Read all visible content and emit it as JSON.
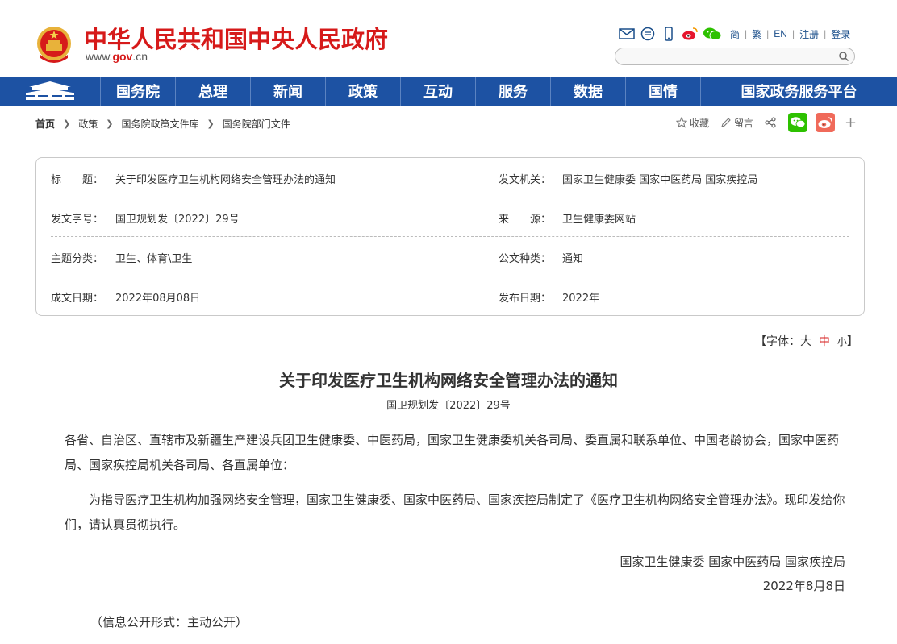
{
  "header": {
    "site_title": "中华人民共和国中央人民政府",
    "url_prefix": "www.",
    "url_gov": "gov",
    "url_suffix": ".cn",
    "lang_links": [
      "简",
      "繁",
      "EN",
      "注册",
      "登录"
    ],
    "icons": [
      "mail-icon",
      "message-icon",
      "mobile-icon",
      "weibo-icon",
      "wechat-icon"
    ],
    "search_placeholder": ""
  },
  "nav": {
    "items": [
      "国务院",
      "总理",
      "新闻",
      "政策",
      "互动",
      "服务",
      "数据",
      "国情",
      "国家政务服务平台"
    ]
  },
  "breadcrumb": [
    "首页",
    "政策",
    "国务院政策文件库",
    "国务院部门文件"
  ],
  "share": {
    "favorite": "收藏",
    "comment": "留言"
  },
  "info": {
    "rows": [
      {
        "l1": "标　　题：",
        "v1": "关于印发医疗卫生机构网络安全管理办法的通知",
        "l2": "发文机关：",
        "v2": "国家卫生健康委  国家中医药局  国家疾控局"
      },
      {
        "l1": "发文字号：",
        "v1": "国卫规划发〔2022〕29号",
        "l2": "来　　源：",
        "v2": "卫生健康委网站"
      },
      {
        "l1": "主题分类：",
        "v1": "卫生、体育\\卫生",
        "l2": "公文种类：",
        "v2": "通知"
      },
      {
        "l1": "成文日期：",
        "v1": "2022年08月08日",
        "l2": "发布日期：",
        "v2": "2022年"
      }
    ]
  },
  "font_switch": {
    "open": "【字体：",
    "large": "大",
    "medium": "中",
    "small": "小",
    "close": "】"
  },
  "article": {
    "title": "关于印发医疗卫生机构网络安全管理办法的通知",
    "doc_no": "国卫规划发〔2022〕29号",
    "para1": "各省、自治区、直辖市及新疆生产建设兵团卫生健康委、中医药局，国家卫生健康委机关各司局、委直属和联系单位、中国老龄协会，国家中医药局、国家疾控局机关各司局、各直属单位：",
    "para2": "为指导医疗卫生机构加强网络安全管理，国家卫生健康委、国家中医药局、国家疾控局制定了《医疗卫生机构网络安全管理办法》。现印发给你们，请认真贯彻执行。",
    "signer": "国家卫生健康委  国家中医药局  国家疾控局",
    "date": "2022年8月8日",
    "disclosure": "（信息公开形式：主动公开）"
  },
  "colors": {
    "brand_red": "#d61a1a",
    "nav_blue": "#1d52a3",
    "wechat_green": "#2dc100",
    "weibo_red": "#e6162d"
  }
}
